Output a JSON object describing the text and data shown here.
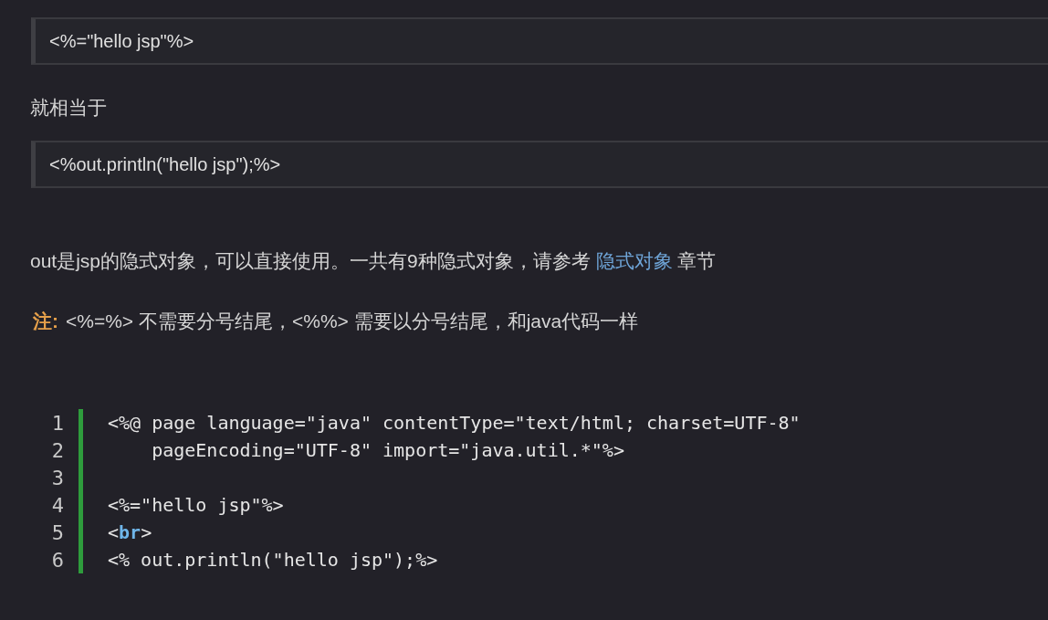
{
  "code_boxes": [
    {
      "text": "<%=\"hello jsp\"%>"
    },
    {
      "text": "<%out.println(\"hello jsp\");%>"
    }
  ],
  "between_text": "就相当于",
  "paragraph": {
    "before": "out是jsp的隐式对象，可以直接使用。一共有9种隐式对象，请参考 ",
    "link": "隐式对象",
    "after": " 章节"
  },
  "note": {
    "label": "注:",
    "text": "<%=%> 不需要分号结尾，<%%> 需要以分号结尾，和java代码一样"
  },
  "code_listing": [
    {
      "number": "1",
      "segments": [
        {
          "kind": "plain",
          "text": "<%@ page language=\"java\" contentType=\"text/html; charset=UTF-8\""
        }
      ]
    },
    {
      "number": "2",
      "segments": [
        {
          "kind": "plain",
          "text": "    pageEncoding=\"UTF-8\" import=\"java.util.*\"%>"
        }
      ]
    },
    {
      "number": "3"
    },
    {
      "number": "4",
      "segments": [
        {
          "kind": "plain",
          "text": "<%=\"hello jsp\"%>"
        }
      ]
    },
    {
      "number": "5",
      "segments": [
        {
          "kind": "plain",
          "text": "<"
        },
        {
          "kind": "tag",
          "text": "br"
        },
        {
          "kind": "plain",
          "text": ">"
        }
      ]
    },
    {
      "number": "6",
      "segments": [
        {
          "kind": "plain",
          "text": "<% out.println(\"hello jsp\");%>"
        }
      ]
    }
  ]
}
